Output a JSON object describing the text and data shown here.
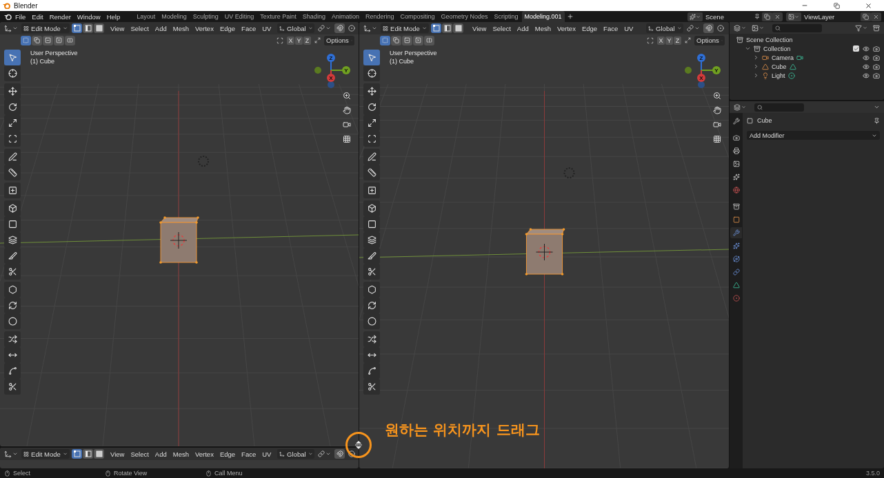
{
  "window": {
    "title": "Blender"
  },
  "menu": [
    "File",
    "Edit",
    "Render",
    "Window",
    "Help"
  ],
  "workspaces": [
    {
      "label": "Layout",
      "selected": false
    },
    {
      "label": "Modeling",
      "selected": false
    },
    {
      "label": "Sculpting",
      "selected": false
    },
    {
      "label": "UV Editing",
      "selected": false
    },
    {
      "label": "Texture Paint",
      "selected": false
    },
    {
      "label": "Shading",
      "selected": false
    },
    {
      "label": "Animation",
      "selected": false
    },
    {
      "label": "Rendering",
      "selected": false
    },
    {
      "label": "Compositing",
      "selected": false
    },
    {
      "label": "Geometry Nodes",
      "selected": false
    },
    {
      "label": "Scripting",
      "selected": false
    },
    {
      "label": "Modeling.001",
      "selected": true
    }
  ],
  "scene": "Scene",
  "view_layer": "ViewLayer",
  "viewports": [
    {
      "mode": "Edit Mode",
      "menus": [
        "View",
        "Select",
        "Add",
        "Mesh",
        "Vertex",
        "Edge",
        "Face",
        "UV"
      ],
      "orientation": "Global",
      "select_modes": [
        {
          "kind": "vertex",
          "selected": true
        },
        {
          "kind": "edge",
          "selected": false
        },
        {
          "kind": "face",
          "selected": false
        }
      ],
      "box_modes": [
        {
          "kind": "set",
          "selected": true
        },
        {
          "kind": "extend",
          "selected": false
        },
        {
          "kind": "subtract",
          "selected": false
        },
        {
          "kind": "invert",
          "selected": false
        },
        {
          "kind": "intersect",
          "selected": false
        }
      ],
      "axes": [
        "X",
        "Y",
        "Z"
      ],
      "options": "Options",
      "view_name": "User Perspective",
      "object_name": "(1) Cube",
      "gizmo": [
        "Z",
        "Y",
        "X"
      ],
      "tools": [
        {
          "kind": "select",
          "selected": true
        },
        {
          "kind": "cursor",
          "selected": false
        },
        {
          "kind": "move",
          "selected": false
        },
        {
          "kind": "rotate",
          "selected": false
        },
        {
          "kind": "scale",
          "selected": false
        },
        {
          "kind": "transform",
          "selected": false
        },
        {
          "kind": "annotate",
          "selected": false
        },
        {
          "kind": "measure",
          "selected": false
        },
        {
          "kind": "add-cube",
          "selected": false
        },
        {
          "kind": "extrude",
          "selected": false
        },
        {
          "kind": "inset",
          "selected": false
        },
        {
          "kind": "bevel",
          "selected": false
        },
        {
          "kind": "loop-cut",
          "selected": false
        },
        {
          "kind": "knife",
          "selected": false
        },
        {
          "kind": "poly-build",
          "selected": false
        },
        {
          "kind": "spin",
          "selected": false
        },
        {
          "kind": "smooth",
          "selected": false
        },
        {
          "kind": "randomize",
          "selected": false
        },
        {
          "kind": "edge-slide",
          "selected": false
        },
        {
          "kind": "shear",
          "selected": false
        },
        {
          "kind": "rip",
          "selected": false
        }
      ]
    },
    {
      "mode": "Edit Mode",
      "menus": [
        "View",
        "Select",
        "Add",
        "Mesh",
        "Vertex",
        "Edge",
        "Face",
        "UV"
      ],
      "orientation": "Global",
      "select_modes": [
        {
          "kind": "vertex",
          "selected": true
        },
        {
          "kind": "edge",
          "selected": false
        },
        {
          "kind": "face",
          "selected": false
        }
      ],
      "box_modes": [
        {
          "kind": "set",
          "selected": true
        },
        {
          "kind": "extend",
          "selected": false
        },
        {
          "kind": "subtract",
          "selected": false
        },
        {
          "kind": "invert",
          "selected": false
        },
        {
          "kind": "intersect",
          "selected": false
        }
      ],
      "axes": [
        "X",
        "Y",
        "Z"
      ],
      "options": "Options",
      "view_name": "User Perspective",
      "object_name": "(1) Cube",
      "gizmo": [
        "Z",
        "Y",
        "X"
      ],
      "tools": [
        {
          "kind": "select",
          "selected": true
        },
        {
          "kind": "cursor",
          "selected": false
        },
        {
          "kind": "move",
          "selected": false
        },
        {
          "kind": "rotate",
          "selected": false
        },
        {
          "kind": "scale",
          "selected": false
        },
        {
          "kind": "transform",
          "selected": false
        },
        {
          "kind": "annotate",
          "selected": false
        },
        {
          "kind": "measure",
          "selected": false
        },
        {
          "kind": "add-cube",
          "selected": false
        },
        {
          "kind": "extrude",
          "selected": false
        },
        {
          "kind": "inset",
          "selected": false
        },
        {
          "kind": "bevel",
          "selected": false
        },
        {
          "kind": "loop-cut",
          "selected": false
        },
        {
          "kind": "knife",
          "selected": false
        },
        {
          "kind": "poly-build",
          "selected": false
        },
        {
          "kind": "spin",
          "selected": false
        },
        {
          "kind": "smooth",
          "selected": false
        },
        {
          "kind": "randomize",
          "selected": false
        },
        {
          "kind": "edge-slide",
          "selected": false
        },
        {
          "kind": "shear",
          "selected": false
        },
        {
          "kind": "rip",
          "selected": false
        }
      ]
    }
  ],
  "bottom_viewport": {
    "mode": "Edit Mode",
    "menus": [
      "View",
      "Select",
      "Add",
      "Mesh",
      "Vertex",
      "Edge",
      "Face",
      "UV"
    ],
    "orientation": "Global",
    "select_modes": [
      {
        "kind": "vertex",
        "selected": true
      },
      {
        "kind": "edge",
        "selected": false
      },
      {
        "kind": "face",
        "selected": false
      }
    ]
  },
  "outliner": {
    "items": [
      {
        "label": "Scene Collection",
        "kind": "scene-collection",
        "children": [
          {
            "label": "Collection",
            "kind": "collection",
            "expanded": true,
            "checked": true,
            "children": [
              {
                "label": "Camera",
                "kind": "camera",
                "expanded": false
              },
              {
                "label": "Cube",
                "kind": "mesh",
                "expanded": false
              },
              {
                "label": "Light",
                "kind": "light",
                "expanded": false
              }
            ]
          }
        ]
      }
    ]
  },
  "properties": {
    "object_name": "Cube",
    "add_modifier": "Add Modifier",
    "tabs": [
      {
        "kind": "tool",
        "selected": false
      },
      {
        "kind": "render",
        "selected": false
      },
      {
        "kind": "output",
        "selected": false
      },
      {
        "kind": "view-layer",
        "selected": false
      },
      {
        "kind": "scene",
        "selected": false
      },
      {
        "kind": "world",
        "selected": false
      },
      {
        "kind": "collection",
        "selected": false
      },
      {
        "kind": "object",
        "selected": false
      },
      {
        "kind": "modifiers",
        "selected": true
      },
      {
        "kind": "particles",
        "selected": false
      },
      {
        "kind": "physics",
        "selected": false
      },
      {
        "kind": "constraints",
        "selected": false
      },
      {
        "kind": "data",
        "selected": false
      },
      {
        "kind": "material",
        "selected": false
      }
    ]
  },
  "status_bar": {
    "items": [
      "Select",
      "Rotate View",
      "Call Menu"
    ],
    "version": "3.5.0"
  },
  "annotation": {
    "text": "원하는 위치까지 드래그"
  }
}
